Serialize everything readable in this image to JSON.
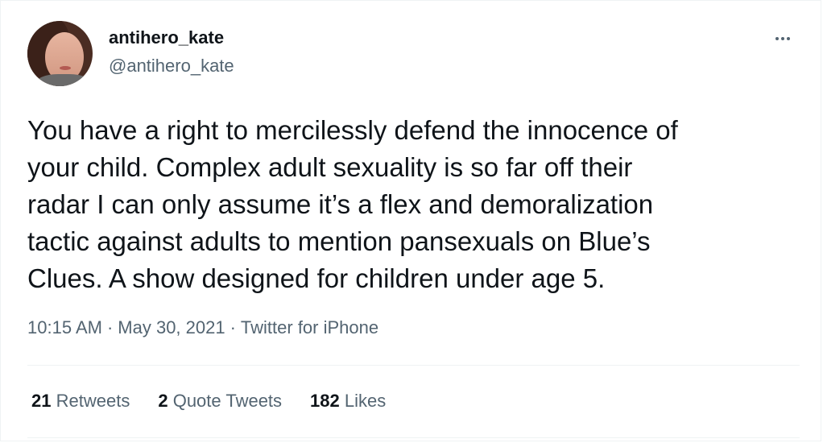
{
  "user": {
    "display_name": "antihero_kate",
    "handle": "@antihero_kate"
  },
  "tweet": {
    "text": "You have a right to mercilessly defend the innocence of\nyour child. Complex adult sexuality is so far off their\nradar I can only assume it’s a flex and demoralization\ntactic against adults to mention pansexuals on Blue’s\nClues. A show designed for children under age 5.",
    "time": "10:15 AM",
    "separator": "·",
    "date": "May 30, 2021",
    "source": "Twitter for iPhone"
  },
  "stats": {
    "retweets_count": "21",
    "retweets_label": "Retweets",
    "quote_count": "2",
    "quote_label": "Quote Tweets",
    "likes_count": "182",
    "likes_label": "Likes"
  },
  "icons": {
    "more": "more-horizontal-icon"
  },
  "colors": {
    "primary_text": "#0f1419",
    "secondary_text": "#536471",
    "divider": "#eff3f4"
  }
}
